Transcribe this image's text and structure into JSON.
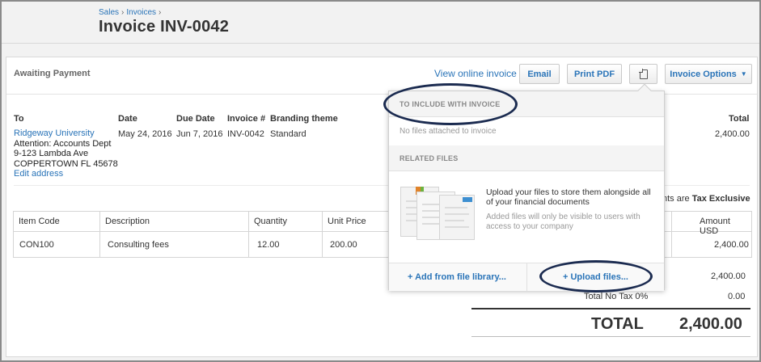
{
  "breadcrumb": {
    "sales": "Sales",
    "invoices": "Invoices",
    "sep": "›"
  },
  "page_title": "Invoice INV-0042",
  "status": "Awaiting Payment",
  "toolbar": {
    "view_online": "View online invoice",
    "email": "Email",
    "print_pdf": "Print PDF",
    "attach_icon": "attachment-icon",
    "invoice_options": "Invoice Options",
    "caret": "▼"
  },
  "info": {
    "labels": {
      "to": "To",
      "date": "Date",
      "due_date": "Due Date",
      "invoice_no": "Invoice #",
      "branding": "Branding theme",
      "total": "Total"
    },
    "to_name": "Ridgeway University",
    "address": [
      "Attention: Accounts Dept",
      "9-123 Lambda Ave",
      "COPPERTOWN FL 45678"
    ],
    "edit_address": "Edit address",
    "date": "May 24, 2016",
    "due_date": "Jun 7, 2016",
    "invoice_no": "INV-0042",
    "branding": "Standard",
    "total": "2,400.00"
  },
  "tax_note": {
    "prefix": "nts are",
    "value": "Tax Exclusive"
  },
  "table": {
    "headers": {
      "item_code": "Item Code",
      "description": "Description",
      "quantity": "Quantity",
      "unit_price": "Unit Price",
      "amount": "Amount USD"
    },
    "rows": [
      {
        "item_code": "CON100",
        "description": "Consulting fees",
        "quantity": "12.00",
        "unit_price": "200.00",
        "amount": "2,400.00"
      }
    ]
  },
  "totals": {
    "subtotal": "2,400.00",
    "tax_label": "Total No Tax 0%",
    "tax_value": "0.00",
    "total_label": "TOTAL",
    "total_value": "2,400.00"
  },
  "popup": {
    "include_header": "TO INCLUDE WITH INVOICE",
    "no_files": "No files attached to invoice",
    "related_header": "RELATED FILES",
    "upload_text": "Upload your files to store them alongside all of your financial documents",
    "upload_sub": "Added files will only be visible to users with access to your company",
    "add_from_library": "+ Add from file library...",
    "upload_files": "+ Upload files..."
  },
  "colors": {
    "link": "#2a74b8",
    "highlight_oval": "#1b2b50",
    "accent_orange": "#e0832a",
    "accent_green": "#6cb33e",
    "accent_blue": "#3d8fd1"
  }
}
